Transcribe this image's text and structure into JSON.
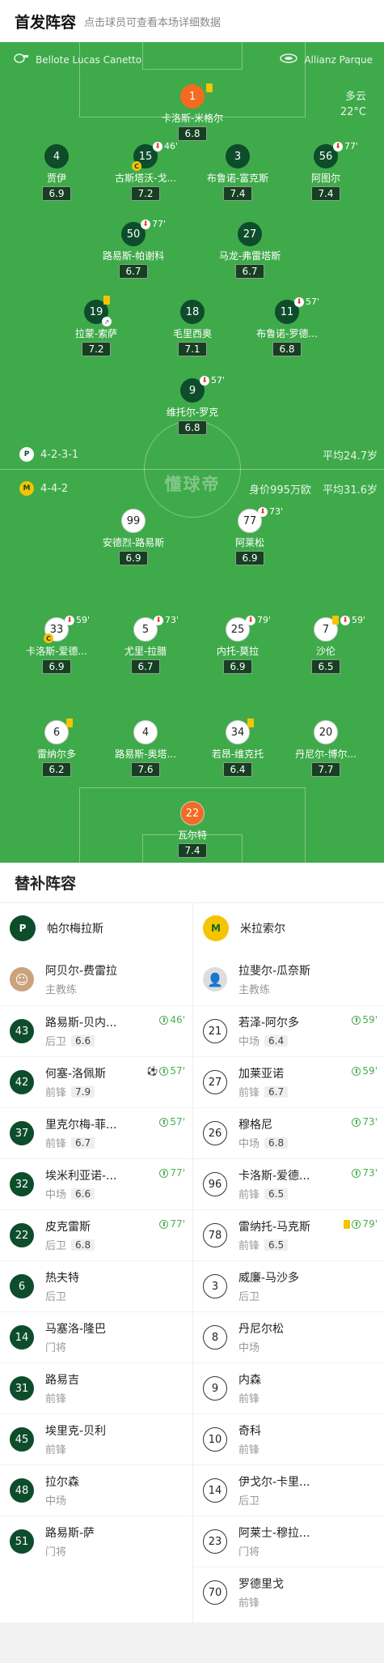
{
  "header": {
    "title": "首发阵容",
    "subtitle": "点击球员可查看本场详细数据"
  },
  "venue": {
    "referee": "Bellote Lucas Canetto",
    "stadium": "Allianz Parque",
    "weather": "多云",
    "temperature": "22°C"
  },
  "home_formation": {
    "formation": "4-2-3-1",
    "avg_age": "平均24.7岁"
  },
  "away_formation": {
    "formation": "4-4-2",
    "value": "身价995万欧",
    "avg_age": "平均31.6岁"
  },
  "watermark": "懂球帝",
  "home_players": [
    {
      "num": "1",
      "name": "卡洛斯-米格尔",
      "rating": "6.8"
    },
    {
      "num": "4",
      "name": "贾伊",
      "rating": "6.9"
    },
    {
      "num": "15",
      "name": "古斯塔沃-戈...",
      "rating": "7.2",
      "sub": "46'"
    },
    {
      "num": "3",
      "name": "布鲁诺-富克斯",
      "rating": "7.4"
    },
    {
      "num": "56",
      "name": "阿图尔",
      "rating": "7.4",
      "sub": "77'"
    },
    {
      "num": "50",
      "name": "路易斯-帕谢科",
      "rating": "6.7",
      "sub": "77'"
    },
    {
      "num": "27",
      "name": "马龙-弗雷塔斯",
      "rating": "6.7"
    },
    {
      "num": "19",
      "name": "拉蒙-索萨",
      "rating": "7.2"
    },
    {
      "num": "18",
      "name": "毛里西奥",
      "rating": "7.1"
    },
    {
      "num": "11",
      "name": "布鲁诺-罗德...",
      "rating": "6.8",
      "sub": "57'"
    },
    {
      "num": "9",
      "name": "维托尔-罗克",
      "rating": "6.8",
      "sub": "57'"
    }
  ],
  "away_players": [
    {
      "num": "99",
      "name": "安德烈-路易斯",
      "rating": "6.9"
    },
    {
      "num": "77",
      "name": "阿莱松",
      "rating": "6.9",
      "sub": "73'"
    },
    {
      "num": "33",
      "name": "卡洛斯-爱德...",
      "rating": "6.9",
      "sub": "59'"
    },
    {
      "num": "5",
      "name": "尤里-拉腊",
      "rating": "6.7",
      "sub": "73'"
    },
    {
      "num": "25",
      "name": "内托-莫拉",
      "rating": "6.9",
      "sub": "79'"
    },
    {
      "num": "7",
      "name": "沙伦",
      "rating": "6.5",
      "sub": "59'"
    },
    {
      "num": "6",
      "name": "雷纳尔多",
      "rating": "6.2"
    },
    {
      "num": "4",
      "name": "路易斯-奥塔...",
      "rating": "7.6"
    },
    {
      "num": "34",
      "name": "若昂-维克托",
      "rating": "6.4"
    },
    {
      "num": "20",
      "name": "丹尼尔-博尔...",
      "rating": "7.7"
    },
    {
      "num": "22",
      "name": "瓦尔特",
      "rating": "7.4"
    }
  ],
  "subs": {
    "title": "替补阵容",
    "home": {
      "team": "帕尔梅拉斯",
      "coach": {
        "name": "阿贝尔-费雷拉",
        "role": "主教练"
      },
      "players": [
        {
          "num": "43",
          "name": "路易斯-贝内...",
          "pos": "后卫",
          "rating": "6.6",
          "minute": "46'"
        },
        {
          "num": "42",
          "name": "何塞-洛佩斯",
          "pos": "前锋",
          "rating": "7.9",
          "minute": "57'"
        },
        {
          "num": "37",
          "name": "里克尔梅-菲...",
          "pos": "前锋",
          "rating": "6.7",
          "minute": "57'"
        },
        {
          "num": "32",
          "name": "埃米利亚诺-...",
          "pos": "中场",
          "rating": "6.6",
          "minute": "77'"
        },
        {
          "num": "22",
          "name": "皮克雷斯",
          "pos": "后卫",
          "rating": "6.8",
          "minute": "77'"
        },
        {
          "num": "6",
          "name": "热夫特",
          "pos": "后卫"
        },
        {
          "num": "14",
          "name": "马塞洛-隆巴",
          "pos": "门将"
        },
        {
          "num": "31",
          "name": "路易吉",
          "pos": "前锋"
        },
        {
          "num": "45",
          "name": "埃里克-贝利",
          "pos": "前锋"
        },
        {
          "num": "48",
          "name": "拉尔森",
          "pos": "中场"
        },
        {
          "num": "51",
          "name": "路易斯-萨",
          "pos": "门将"
        }
      ]
    },
    "away": {
      "team": "米拉索尔",
      "coach": {
        "name": "拉斐尔-瓜奈斯",
        "role": "主教练"
      },
      "players": [
        {
          "num": "21",
          "name": "若泽-阿尔多",
          "pos": "中场",
          "rating": "6.4",
          "minute": "59'"
        },
        {
          "num": "27",
          "name": "加莱亚诺",
          "pos": "前锋",
          "rating": "6.7",
          "minute": "59'"
        },
        {
          "num": "26",
          "name": "穆格尼",
          "pos": "中场",
          "rating": "6.8",
          "minute": "73'"
        },
        {
          "num": "96",
          "name": "卡洛斯-爱德...",
          "pos": "前锋",
          "rating": "6.5",
          "minute": "73'"
        },
        {
          "num": "78",
          "name": "雷纳托-马克斯",
          "pos": "前锋",
          "rating": "6.5",
          "minute": "79'"
        },
        {
          "num": "3",
          "name": "威廉-马沙多",
          "pos": "后卫"
        },
        {
          "num": "8",
          "name": "丹尼尔松",
          "pos": "中场"
        },
        {
          "num": "9",
          "name": "内森",
          "pos": "前锋"
        },
        {
          "num": "10",
          "name": "奇科",
          "pos": "前锋"
        },
        {
          "num": "14",
          "name": "伊戈尔-卡里...",
          "pos": "后卫"
        },
        {
          "num": "23",
          "name": "阿莱士-穆拉...",
          "pos": "门将"
        },
        {
          "num": "70",
          "name": "罗德里戈",
          "pos": "前锋"
        }
      ]
    }
  }
}
